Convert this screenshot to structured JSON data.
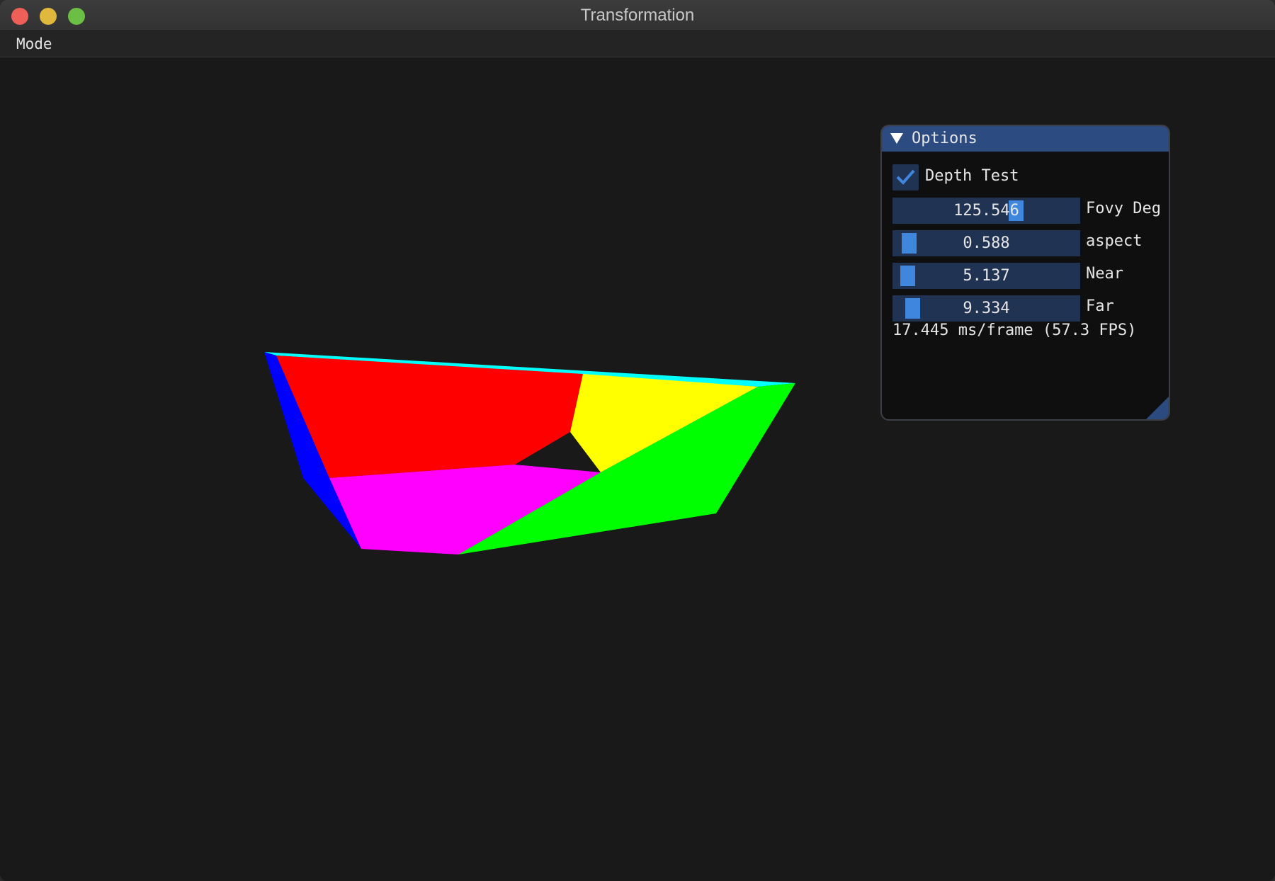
{
  "window": {
    "title": "Transformation"
  },
  "menubar": {
    "items": [
      {
        "label": "Mode"
      }
    ]
  },
  "options_panel": {
    "title": "Options",
    "collapsed": false,
    "depth_test": {
      "label": "Depth Test",
      "checked": true
    },
    "sliders": [
      {
        "label": "Fovy Deg",
        "value": "125.546",
        "grab_fraction": 0.68
      },
      {
        "label": "aspect",
        "value": "0.588",
        "grab_fraction": 0.04
      },
      {
        "label": "Near",
        "value": "5.137",
        "grab_fraction": 0.03
      },
      {
        "label": "Far",
        "value": "9.334",
        "grab_fraction": 0.06
      }
    ],
    "fps_readout": "17.445 ms/frame (57.3 FPS)"
  },
  "scene": {
    "face_colors": {
      "cyan": "#00ffff",
      "blue": "#0000ff",
      "red": "#ff0000",
      "yellow": "#ffff00",
      "magenta": "#ff00ff",
      "green": "#00ff00"
    }
  },
  "colors": {
    "background": "#191919",
    "panel_header": "#2c4b80",
    "slider_frame": "#213352",
    "slider_grab": "#3f86dd"
  }
}
